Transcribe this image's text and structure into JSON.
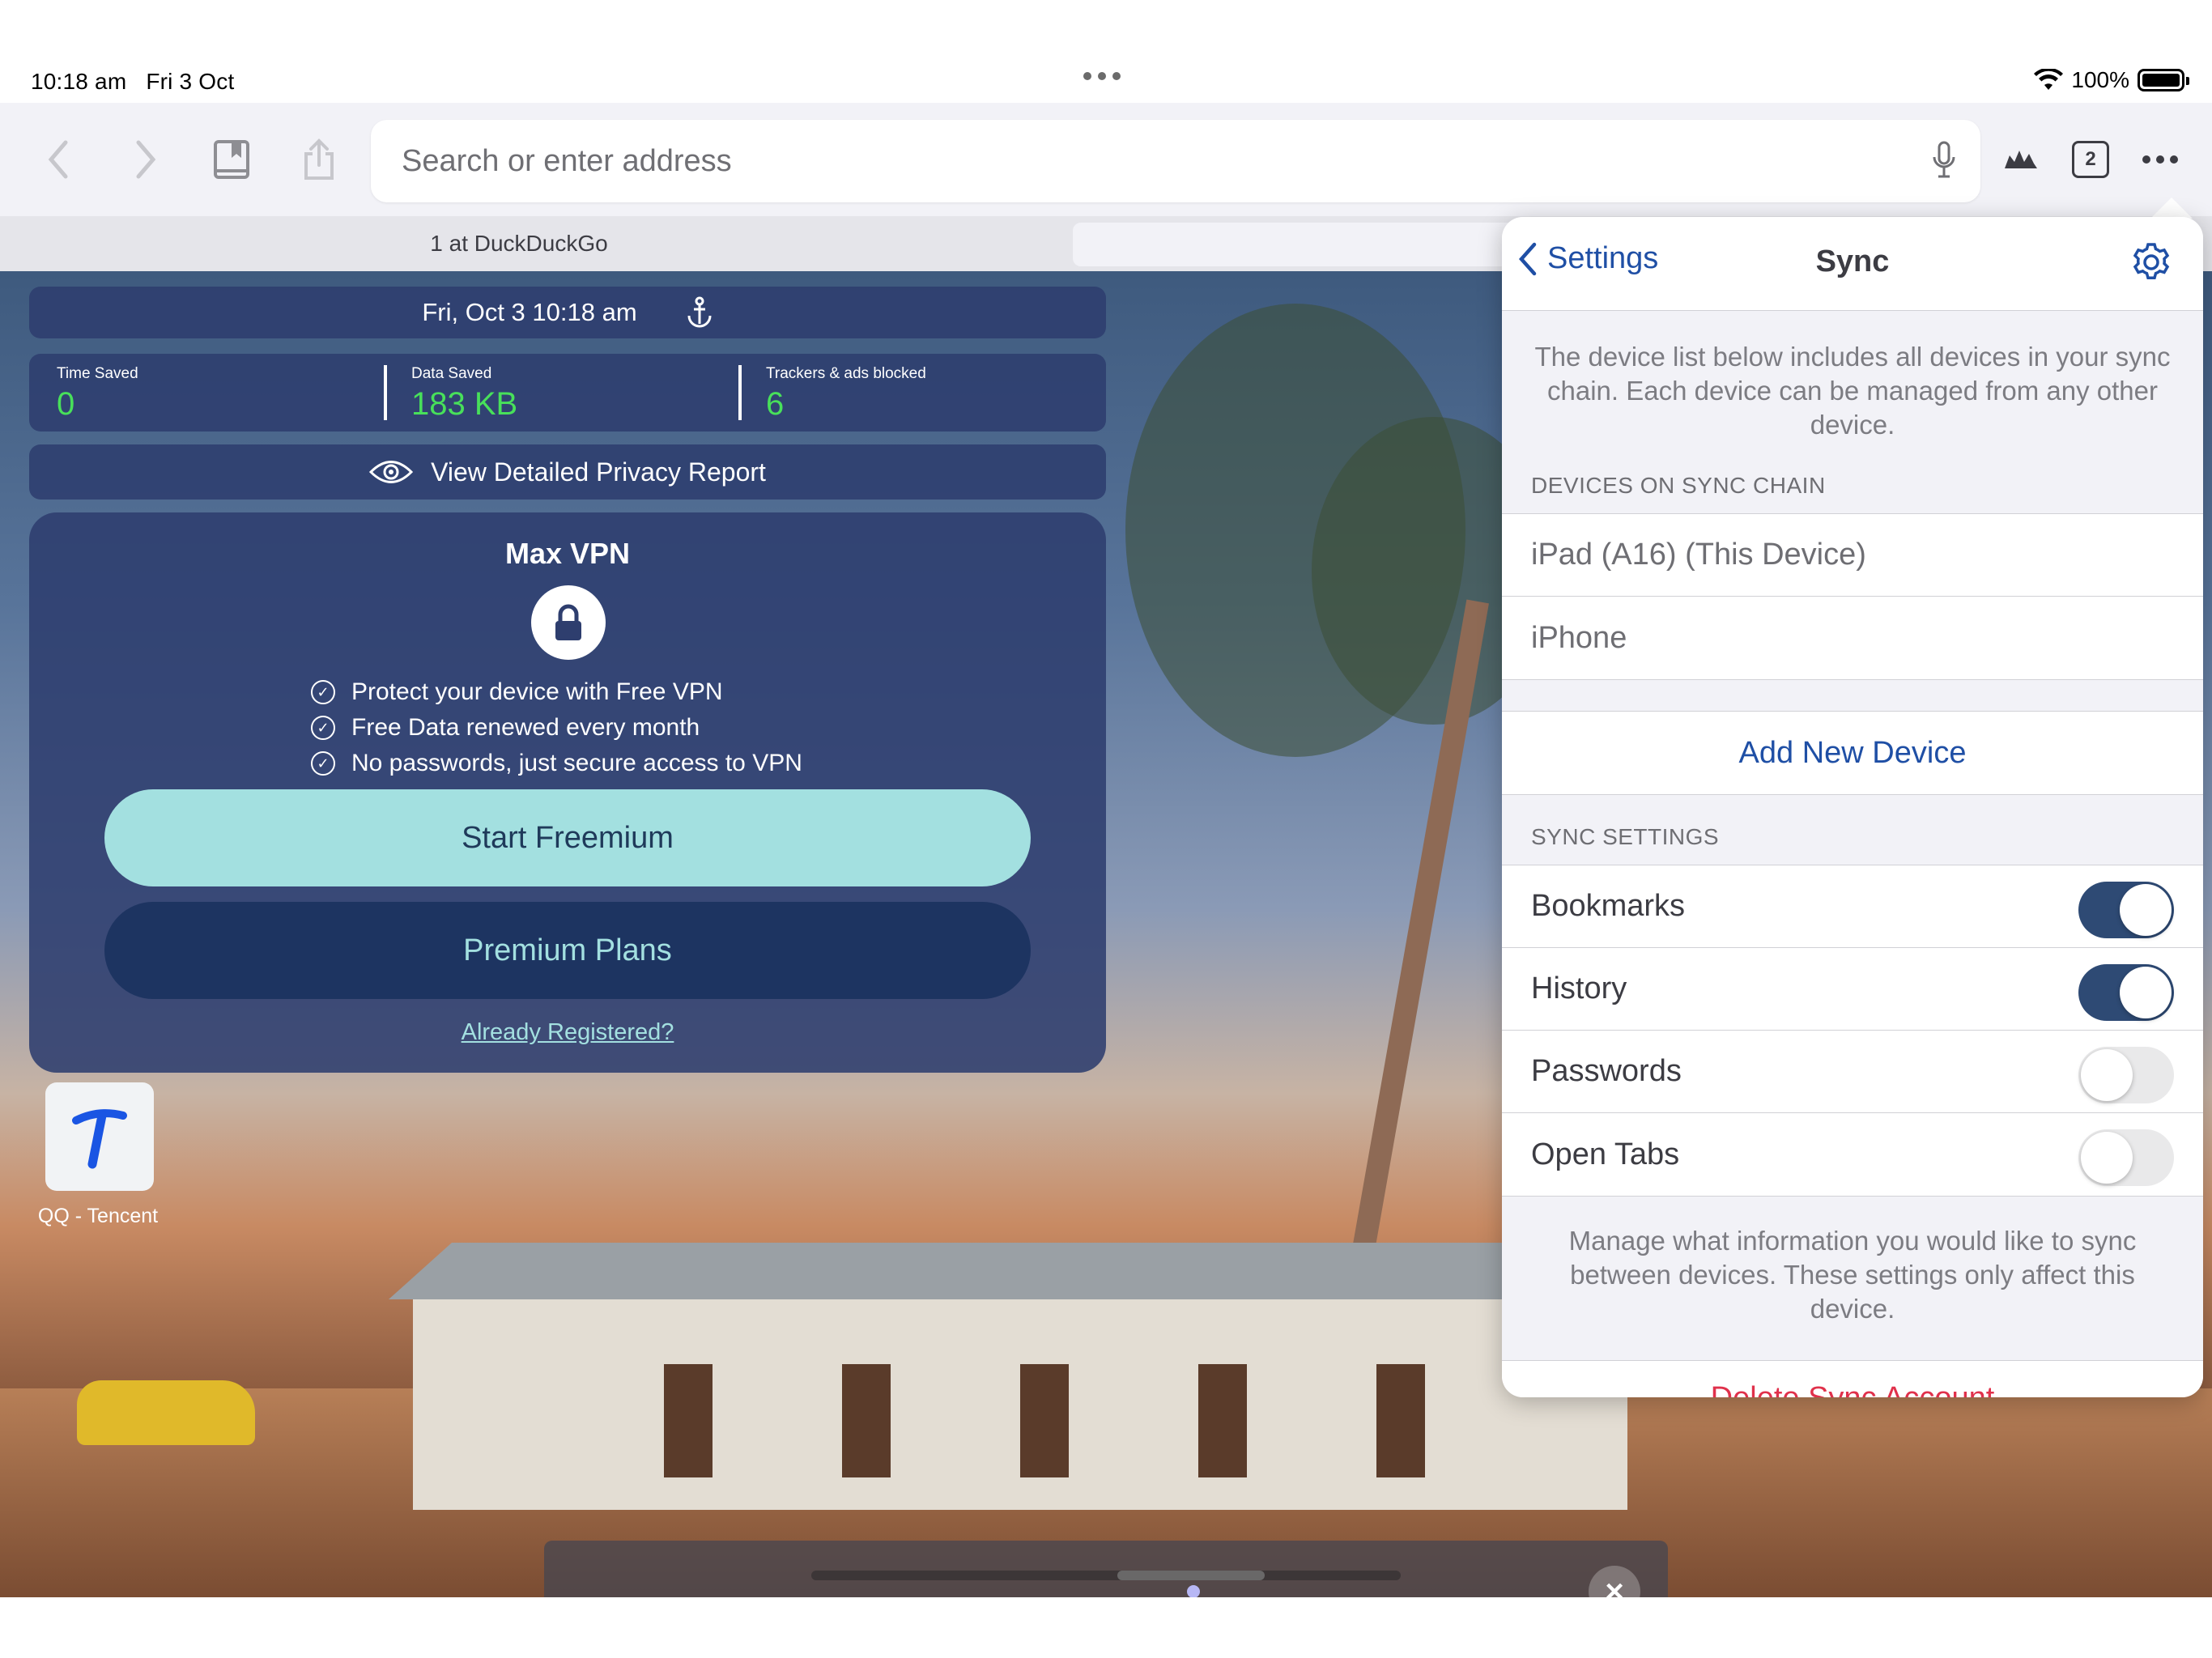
{
  "status_bar": {
    "time": "10:18 am",
    "date": "Fri 3 Oct",
    "battery": "100%",
    "battery_level": 1.0
  },
  "toolbar": {
    "back_icon": "chevron-left-icon",
    "forward_icon": "chevron-right-icon",
    "bookmarks_icon": "book-icon",
    "share_icon": "share-icon",
    "search_placeholder": "Search or enter address",
    "mic_icon": "microphone-icon",
    "tab_count": "2",
    "more_icon": "ellipsis-icon"
  },
  "tabs": {
    "active_tab_title": "1 at DuckDuckGo"
  },
  "privacy": {
    "date_time": "Fri, Oct 3 10:18 am",
    "stats": [
      {
        "label": "Time Saved",
        "value": "0"
      },
      {
        "label": "Data Saved",
        "value": "183 KB"
      },
      {
        "label": "Trackers & ads blocked",
        "value": "6"
      }
    ],
    "report_label": "View Detailed Privacy Report"
  },
  "vpn": {
    "title": "Max VPN",
    "features": [
      "Protect your device with Free VPN",
      "Free Data renewed every month",
      "No passwords, just secure access to VPN"
    ],
    "start_label": "Start Freemium",
    "premium_label": "Premium Plans",
    "already_label": "Already Registered?"
  },
  "bookmark_tile": {
    "label": "QQ - Tencent",
    "accent": "#1a55e3"
  },
  "sync_popover": {
    "back_label": "Settings",
    "title": "Sync",
    "intro": "The device list below includes all devices in your sync chain. Each device can be managed from any other device.",
    "devices_header": "DEVICES ON SYNC CHAIN",
    "devices": [
      "iPad (A16) (This Device)",
      "iPhone"
    ],
    "add_device_label": "Add New Device",
    "settings_header": "SYNC SETTINGS",
    "settings": [
      {
        "label": "Bookmarks",
        "on": true
      },
      {
        "label": "History",
        "on": true
      },
      {
        "label": "Passwords",
        "on": false
      },
      {
        "label": "Open Tabs",
        "on": false
      }
    ],
    "footer": "Manage what information you would like to sync between devices. These settings only affect this device.",
    "delete_label": "Delete Sync Account",
    "accent": "#1f4fa5",
    "toggle_on_color": "#2e4a74",
    "delete_color": "#e0314b"
  }
}
